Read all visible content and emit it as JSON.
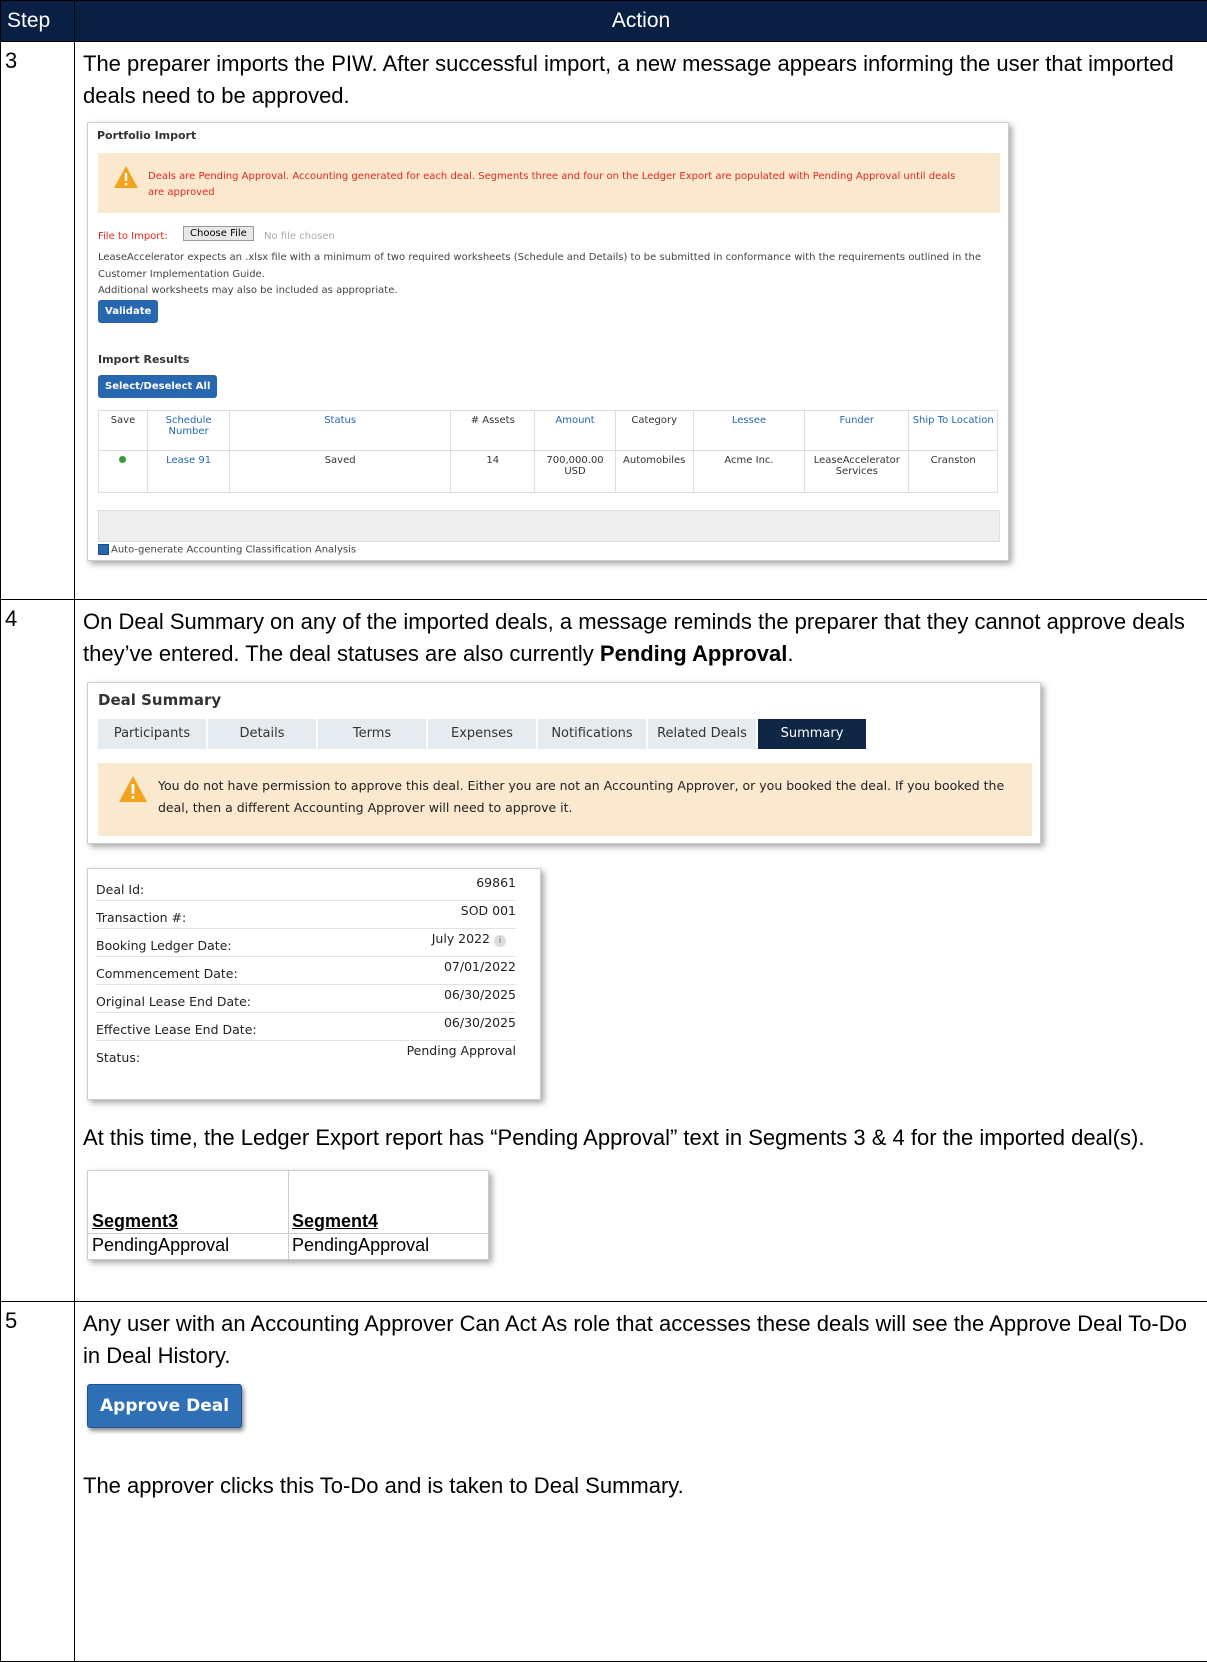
{
  "header": {
    "step": "Step",
    "action": "Action"
  },
  "step3": {
    "num": "3",
    "text": "The preparer imports the PIW. After successful import, a new message appears informing the user that imported deals need to be approved.",
    "shot": {
      "title": "Portfolio Import",
      "alert": "Deals are Pending Approval. Accounting generated for each deal. Segments three and four on the Ledger Export are populated with Pending Approval until deals are approved",
      "file_label": "File to Import:",
      "choose_file": "Choose File",
      "no_file": "No file chosen",
      "desc": "LeaseAccelerator expects an .xlsx file with a minimum of two required worksheets (Schedule and Details) to be submitted in conformance with the requirements outlined in the Customer Implementation Guide.",
      "desc2": "Additional worksheets may also be included as appropriate.",
      "validate": "Validate",
      "import_results": "Import Results",
      "select_all": "Select/Deselect All",
      "columns": [
        "Save",
        "Schedule Number",
        "Status",
        "# Assets",
        "Amount",
        "Category",
        "Lessee",
        "Funder",
        "Ship To Location"
      ],
      "row": {
        "schedule": "Lease 91",
        "status": "Saved",
        "assets": "14",
        "amount": "700,000.00 USD",
        "category": "Automobiles",
        "lessee": "Acme Inc.",
        "funder": "LeaseAccelerator Services",
        "ship_to": "Cranston"
      },
      "auto_label": "Auto-generate Accounting Classification Analysis"
    }
  },
  "step4": {
    "num": "4",
    "text_a": "On Deal Summary on any of the imported deals, a message reminds the preparer that they cannot approve deals they’ve entered. The deal statuses are also currently ",
    "text_bold": "Pending Approval",
    "text_end": ".",
    "shot": {
      "title": "Deal Summary",
      "tabs": [
        "Participants",
        "Details",
        "Terms",
        "Expenses",
        "Notifications",
        "Related Deals",
        "Summary"
      ],
      "active_tab": "Summary",
      "alert": "You do not have permission to approve this deal. Either you are not an Accounting Approver, or you booked the deal. If you booked the deal, then a different Accounting Approver will need to approve it."
    },
    "details": [
      {
        "label": "Deal Id:",
        "value": "69861"
      },
      {
        "label": "Transaction #:",
        "value": "SOD 001"
      },
      {
        "label": "Booking Ledger Date:",
        "value": "July 2022"
      },
      {
        "label": "Commencement Date:",
        "value": "07/01/2022"
      },
      {
        "label": "Original Lease End Date:",
        "value": "06/30/2025"
      },
      {
        "label": "Effective Lease End Date:",
        "value": "06/30/2025"
      },
      {
        "label": "Status:",
        "value": "Pending Approval"
      }
    ],
    "text2": "At this time, the Ledger Export report has “Pending Approval” text in Segments 3 & 4 for the imported deal(s).",
    "segments": {
      "h1": "Segment3",
      "h2": "Segment4",
      "v1": "PendingApproval",
      "v2": "PendingApproval"
    }
  },
  "step5": {
    "num": "5",
    "text": "Any user with an Accounting Approver Can Act As role that accesses these deals will see the Approve Deal To-Do in Deal History.",
    "button": "Approve Deal",
    "text2": "The approver clicks this To-Do and is taken to Deal Summary."
  },
  "colors": {
    "header_bg": "#0a1f44",
    "alert_bg": "#fbe9cf",
    "primary_button": "#2667b0",
    "active_tab": "#0f2647",
    "warning_text": "#e0281e"
  }
}
